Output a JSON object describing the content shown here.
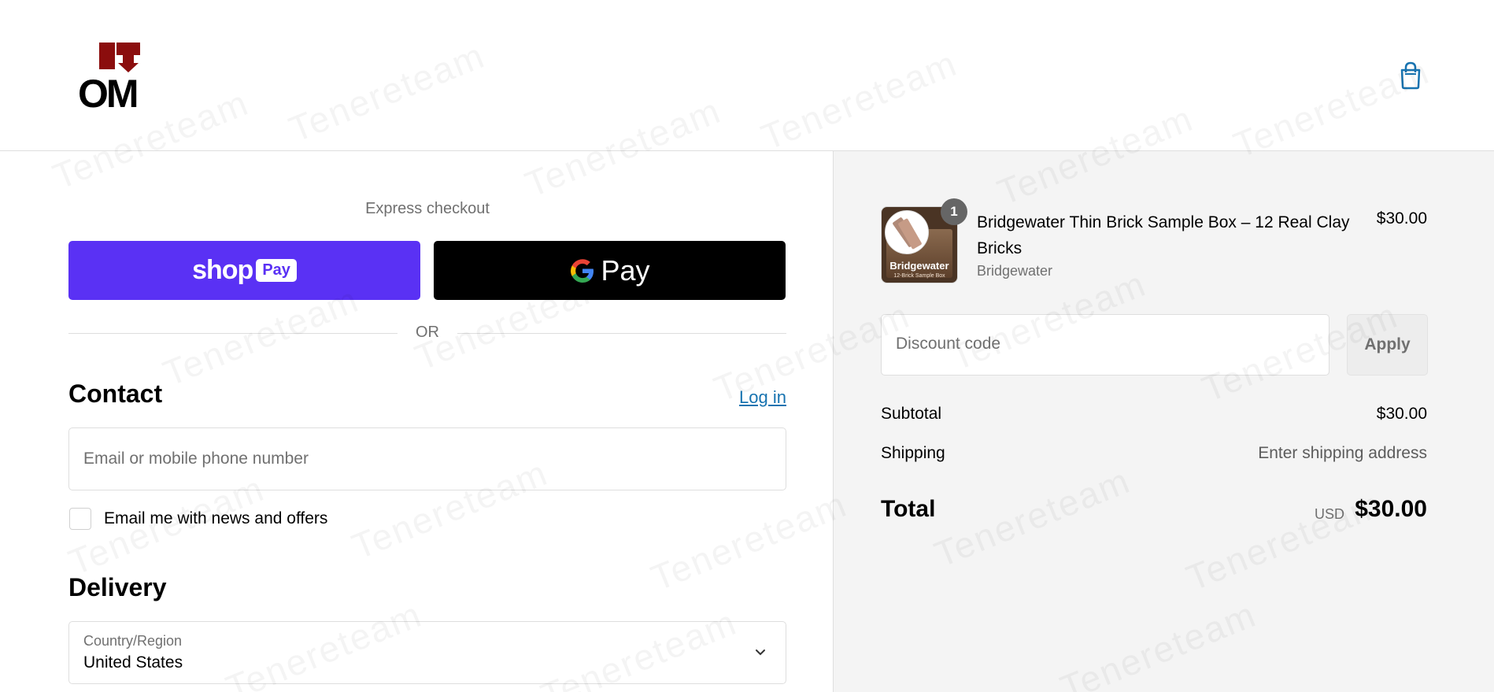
{
  "watermark": "Tenereteam",
  "header": {
    "logo_text": "OM",
    "cart_icon": "shopping-bag-icon"
  },
  "express": {
    "title": "Express checkout",
    "shop_pay": {
      "word": "shop",
      "badge": "Pay"
    },
    "google_pay": {
      "g": "G",
      "word": "Pay"
    },
    "or_label": "OR"
  },
  "contact": {
    "title": "Contact",
    "login_label": "Log in",
    "email_placeholder": "Email or mobile phone number",
    "newsletter_label": "Email me with news and offers"
  },
  "delivery": {
    "title": "Delivery",
    "country_label": "Country/Region",
    "country_value": "United States"
  },
  "order": {
    "item": {
      "name": "Bridgewater Thin Brick Sample Box – 12 Real Clay Bricks",
      "vendor": "Bridgewater",
      "price": "$30.00",
      "quantity": "1",
      "thumb_caption": "Bridgewater",
      "thumb_subcaption": "12-Brick Sample Box"
    },
    "discount_placeholder": "Discount code",
    "apply_label": "Apply",
    "subtotal_label": "Subtotal",
    "subtotal_value": "$30.00",
    "shipping_label": "Shipping",
    "shipping_value": "Enter shipping address",
    "total_label": "Total",
    "total_currency": "USD",
    "total_value": "$30.00"
  },
  "colors": {
    "shop_pay": "#5a31f4",
    "gpay": "#000000",
    "link": "#1773b0",
    "logo_red": "#8b0d0d",
    "summary_bg": "#f4f4f4"
  }
}
